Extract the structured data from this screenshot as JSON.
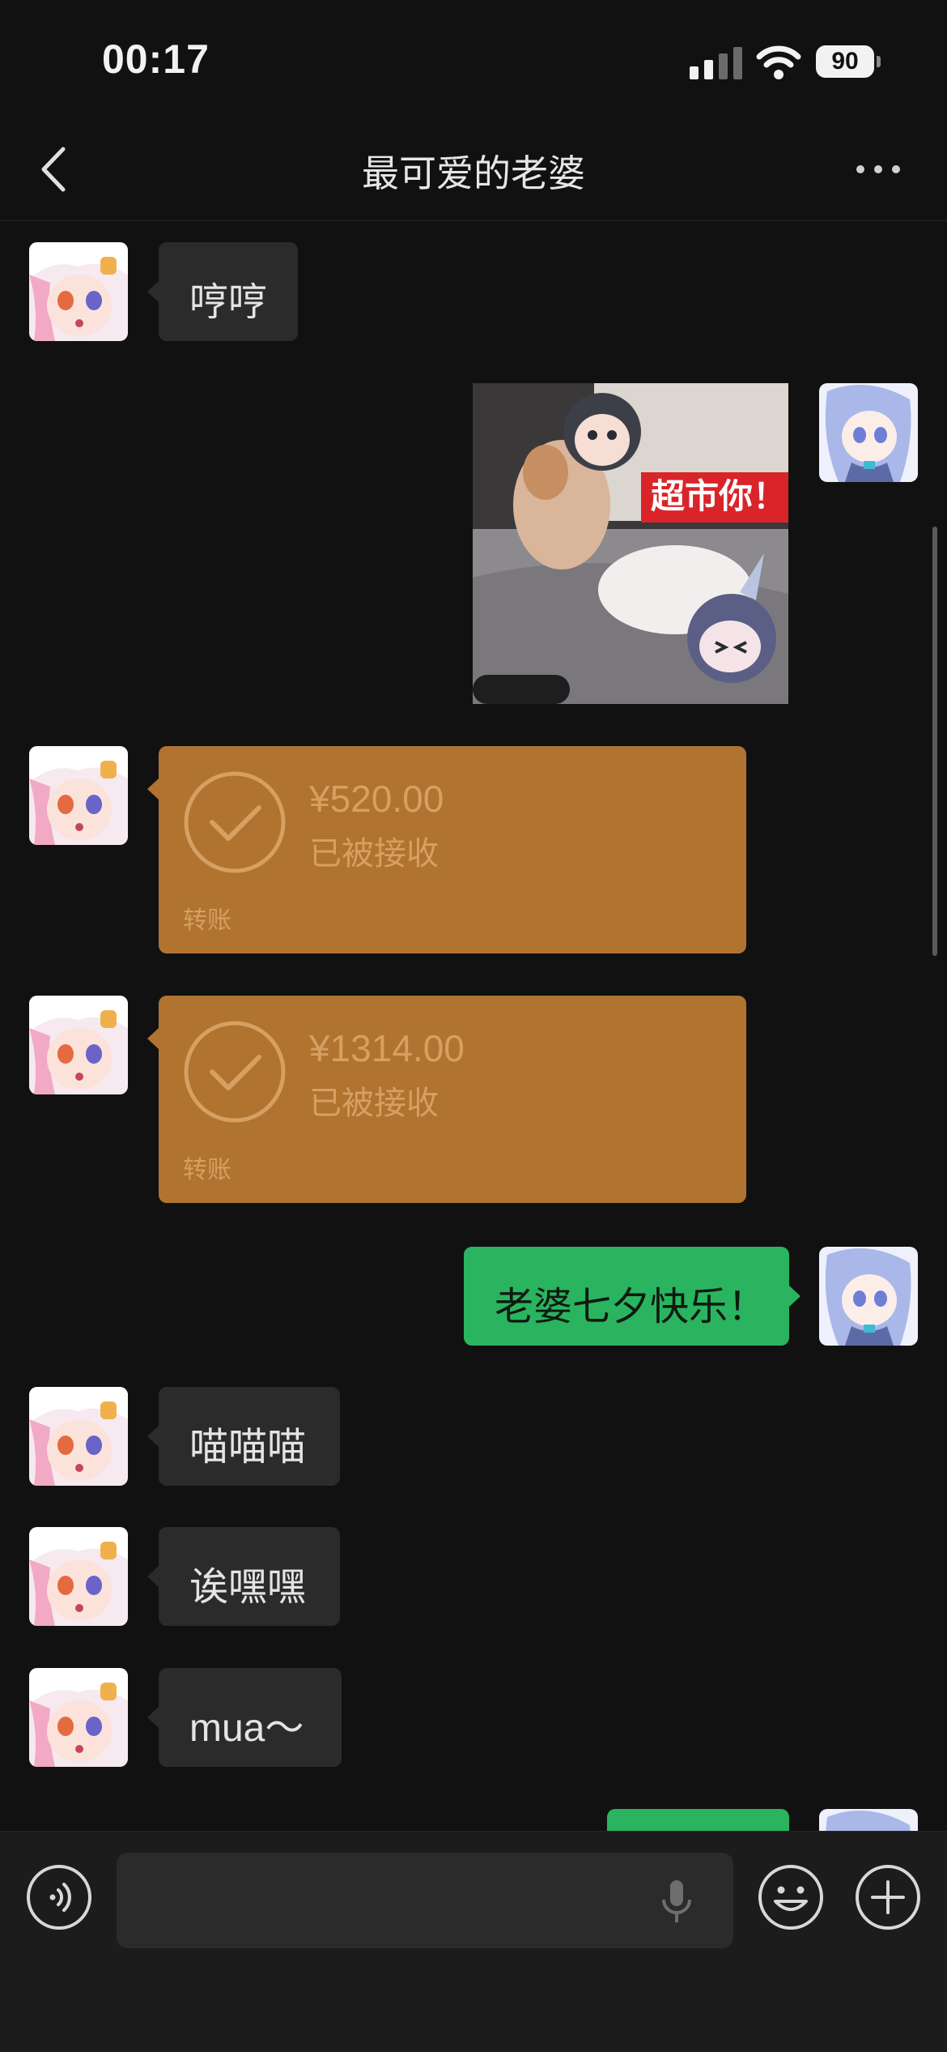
{
  "status_bar": {
    "time": "00:17",
    "battery": "90"
  },
  "header": {
    "title": "最可爱的老婆"
  },
  "messages": {
    "m1": "哼哼",
    "sticker_text": "超市你！",
    "t1": {
      "amount": "¥520.00",
      "status": "已被接收",
      "label": "转账"
    },
    "t2": {
      "amount": "¥1314.00",
      "status": "已被接收",
      "label": "转账"
    },
    "m_out1": "老婆七夕快乐！",
    "m2": "喵喵喵",
    "m3": "诶嘿嘿",
    "m4": "mua～"
  },
  "colors": {
    "incoming_bubble": "#2b2b2b",
    "outgoing_bubble": "#2ab45f",
    "transfer_card": "#b07330",
    "background": "#111111"
  },
  "icons": {
    "back": "chevron-left-icon",
    "more": "more-dots-icon",
    "voice": "voice-icon",
    "mic": "mic-icon",
    "emoji": "emoji-icon",
    "plus": "plus-icon"
  }
}
